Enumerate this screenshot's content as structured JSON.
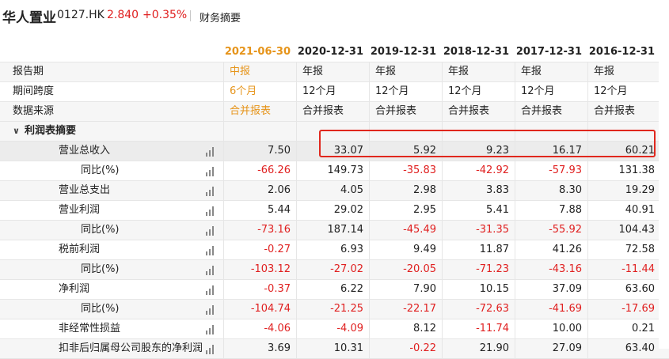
{
  "header": {
    "company_name": "华人置业",
    "stock_code": "0127.HK",
    "price": "2.840",
    "change": "+0.35%",
    "tab_label": "财务摘要"
  },
  "columns": [
    "2021-06-30",
    "2020-12-31",
    "2019-12-31",
    "2018-12-31",
    "2017-12-31",
    "2016-12-31"
  ],
  "rows": [
    {
      "label": "报告期",
      "values": [
        "中报",
        "年报",
        "年报",
        "年报",
        "年报",
        "年报"
      ]
    },
    {
      "label": "期间跨度",
      "values": [
        "6个月",
        "12个月",
        "12个月",
        "12个月",
        "12个月",
        "12个月"
      ]
    },
    {
      "label": "数据来源",
      "values": [
        "合并报表",
        "合并报表",
        "合并报表",
        "合并报表",
        "合并报表",
        "合并报表"
      ]
    },
    {
      "label": "利润表摘要",
      "values": [
        "",
        "",
        "",
        "",
        "",
        ""
      ]
    },
    {
      "label": "营业总收入",
      "values": [
        "7.50",
        "33.07",
        "5.92",
        "9.23",
        "16.17",
        "60.21"
      ]
    },
    {
      "label": "同比(%)",
      "values": [
        "-66.26",
        "149.73",
        "-35.83",
        "-42.92",
        "-57.93",
        "131.38"
      ]
    },
    {
      "label": "营业总支出",
      "values": [
        "2.06",
        "4.05",
        "2.98",
        "3.83",
        "8.30",
        "19.29"
      ]
    },
    {
      "label": "营业利润",
      "values": [
        "5.44",
        "29.02",
        "2.95",
        "5.41",
        "7.88",
        "40.91"
      ]
    },
    {
      "label": "同比(%)",
      "values": [
        "-73.16",
        "187.14",
        "-45.49",
        "-31.35",
        "-55.92",
        "104.43"
      ]
    },
    {
      "label": "税前利润",
      "values": [
        "-0.27",
        "6.93",
        "9.49",
        "11.87",
        "41.26",
        "72.58"
      ]
    },
    {
      "label": "同比(%)",
      "values": [
        "-103.12",
        "-27.02",
        "-20.05",
        "-71.23",
        "-43.16",
        "-11.44"
      ]
    },
    {
      "label": "净利润",
      "values": [
        "-0.37",
        "6.22",
        "7.90",
        "10.15",
        "37.09",
        "63.60"
      ]
    },
    {
      "label": "同比(%)",
      "values": [
        "-104.74",
        "-21.25",
        "-22.17",
        "-72.63",
        "-41.69",
        "-17.69"
      ]
    },
    {
      "label": "非经常性损益",
      "values": [
        "-4.06",
        "-4.09",
        "8.12",
        "-11.74",
        "10.00",
        "0.21"
      ]
    },
    {
      "label": "扣非后归属母公司股东的净利润",
      "values": [
        "3.69",
        "10.31",
        "-0.22",
        "21.90",
        "27.09",
        "63.40"
      ]
    }
  ],
  "colors": {
    "negative": "#e02020",
    "active_column": "#e6941a",
    "highlight_border": "#e0281e"
  },
  "icons": {
    "row_chart": "bar-chart-icon",
    "section_toggle": "chevron-down-icon"
  }
}
